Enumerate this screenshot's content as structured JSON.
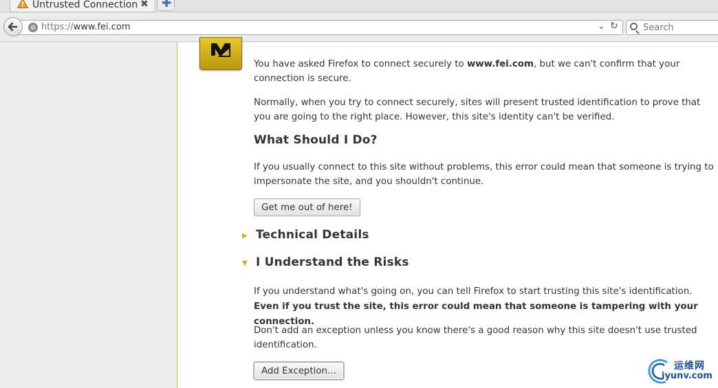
{
  "tab": {
    "title": "Untrusted Connection",
    "close_glyph": "✖",
    "new_tab_glyph": "✚",
    "icon": "warning-triangle-icon"
  },
  "navbar": {
    "back_glyph": "🡐",
    "url_scheme": "https://",
    "url_host": "www.fei.com",
    "dropmarker_glyph": "⌄",
    "reload_glyph": "↻",
    "search_placeholder": "Search"
  },
  "error": {
    "para1_prefix": "You have asked Firefox to connect securely to ",
    "para1_host": "www.fei.com",
    "para1_suffix": ", but we can't confirm that your connection is secure.",
    "para2": "Normally, when you try to connect securely, sites will present trusted identification to prove that you are going to the right place. However, this site's identity can't be verified.",
    "what_heading": "What Should I Do?",
    "what_para": "If you usually connect to this site without problems, this error could mean that someone is trying to impersonate the site, and you shouldn't continue.",
    "get_out_button": "Get me out of here!",
    "technical_heading": "Technical Details",
    "risks_heading": "I Understand the Risks",
    "risks_para_plain": "If you understand what's going on, you can tell Firefox to start trusting this site's identification. ",
    "risks_para_bold": "Even if you trust the site, this error could mean that someone is tampering with your connection.",
    "risks_para2": "Don't add an exception unless you know there's a good reason why this site doesn't use trusted identification.",
    "add_exception_button": "Add Exception...",
    "collapsed_twisty": "▶",
    "expanded_twisty": "▼"
  },
  "watermark": {
    "cn": "运维网",
    "en": "iyunv.com"
  },
  "colors": {
    "accent_yellow": "#e0a800",
    "cert_icon": "#d9b71e",
    "watermark_blue": "#1b4f9e"
  }
}
